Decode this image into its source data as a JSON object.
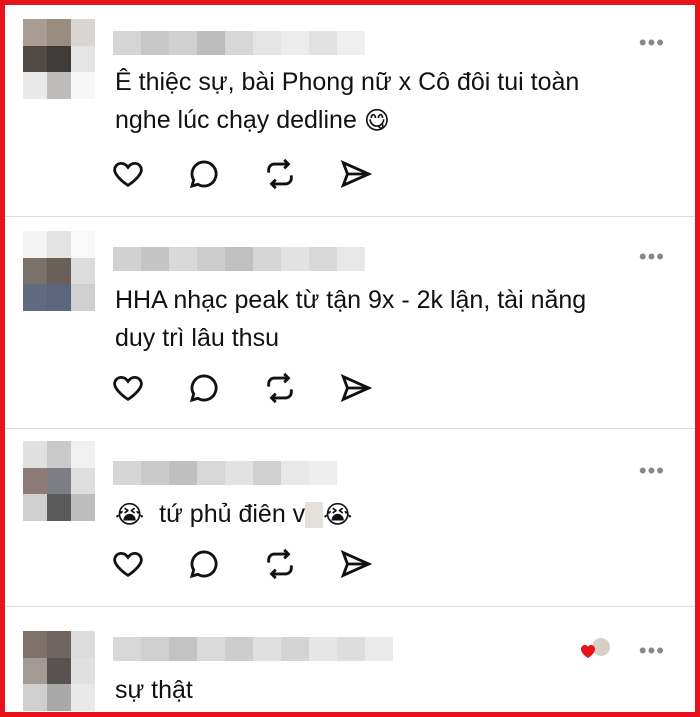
{
  "comments": [
    {
      "text_lines": [
        "Ê thiệc sự, bài Phong nữ x Cô đôi tui toàn",
        "nghe lúc chạy dedline"
      ],
      "emoji": "😋",
      "more_icon": "ellipsis-icon"
    },
    {
      "text_lines": [
        "HHA nhạc peak từ tận 9x - 2k lận, tài năng",
        "duy trì lâu thsu"
      ],
      "more_icon": "ellipsis-icon"
    },
    {
      "text_prefix_emoji": "😭",
      "text": "tứ phủ điên v",
      "emoji": "😭",
      "more_icon": "ellipsis-icon"
    },
    {
      "text": "sự thật",
      "reaction": "heart-icon",
      "more_icon": "ellipsis-icon"
    }
  ],
  "actions": [
    "heart-icon",
    "comment-icon",
    "repost-icon",
    "share-icon"
  ],
  "colors": {
    "frame": "#e8121a",
    "divider": "#dcdcdc",
    "icon": "#111111",
    "more": "#888888"
  }
}
